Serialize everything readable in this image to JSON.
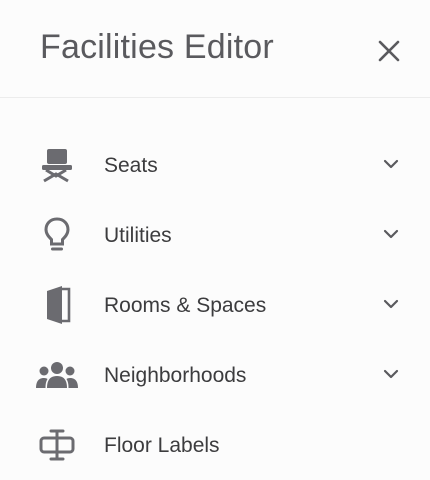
{
  "header": {
    "title": "Facilities Editor",
    "close_icon": "close-icon"
  },
  "menu": {
    "items": [
      {
        "label": "Seats",
        "icon": "seat-icon",
        "expandable": true
      },
      {
        "label": "Utilities",
        "icon": "lightbulb-icon",
        "expandable": true
      },
      {
        "label": "Rooms & Spaces",
        "icon": "door-icon",
        "expandable": true
      },
      {
        "label": "Neighborhoods",
        "icon": "people-group-icon",
        "expandable": true
      },
      {
        "label": "Floor Labels",
        "icon": "floor-label-icon",
        "expandable": false
      }
    ]
  },
  "colors": {
    "background": "#fcfcfc",
    "icon": "#6b6b70",
    "text": "#3c3c3e",
    "title": "#5a5a5e",
    "divider": "#ececec"
  }
}
